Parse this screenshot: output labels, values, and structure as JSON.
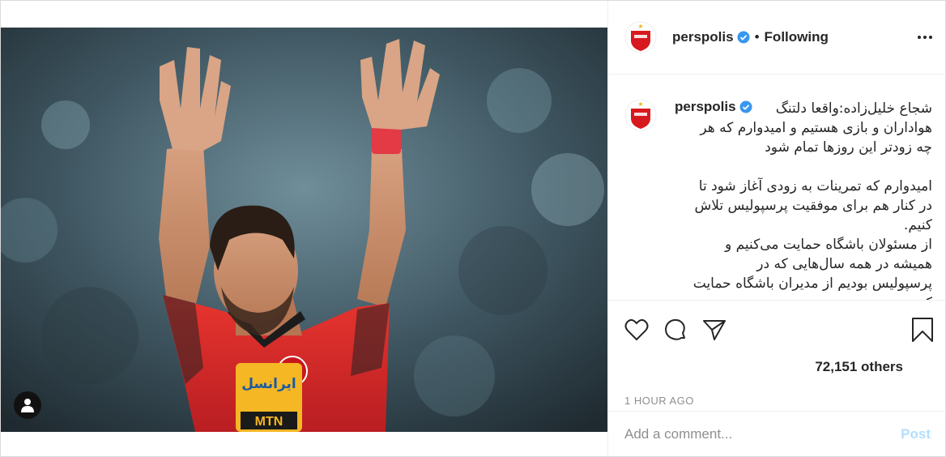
{
  "post": {
    "username": "perspolis",
    "follow_status": "Following",
    "separator": "•",
    "caption_lines": [
      "شجاع خلیل‌زاده:واقعا دلتنگ",
      "هواداران و بازی هستیم و امیدوارم که هر\nچه زودتر این روزها تمام شود\n\nامیدوارم که تمرینات به زودی آغاز شود تا\nدر کنار هم برای موفقیت پرسپولیس تلاش\nکنیم.\nاز مسئولان باشگاه حمایت می‌کنیم و\nهمیشه در همه سال‌هایی که در\nپرسپولیس بودیم از مدیران باشگاه حمایت\nکردیم"
    ],
    "likes": "72,151 others",
    "timestamp": "1 HOUR AGO",
    "comment_placeholder": "Add a comment...",
    "post_button": "Post"
  },
  "photo": {
    "jersey_sponsor_top": "ایرانسل",
    "jersey_sponsor_bottom": "MTN"
  },
  "icons": {
    "verified": "verified-badge-icon",
    "more": "more-options-icon",
    "like": "heart-icon",
    "comment": "comment-icon",
    "share": "share-icon",
    "save": "bookmark-icon",
    "tag": "user-tag-icon"
  },
  "colors": {
    "verified": "#3897f0",
    "post_button": "#b2dffc",
    "jersey_red": "#e0262b",
    "club_red": "#d7191f",
    "secondary_text": "#8e8e8e"
  }
}
